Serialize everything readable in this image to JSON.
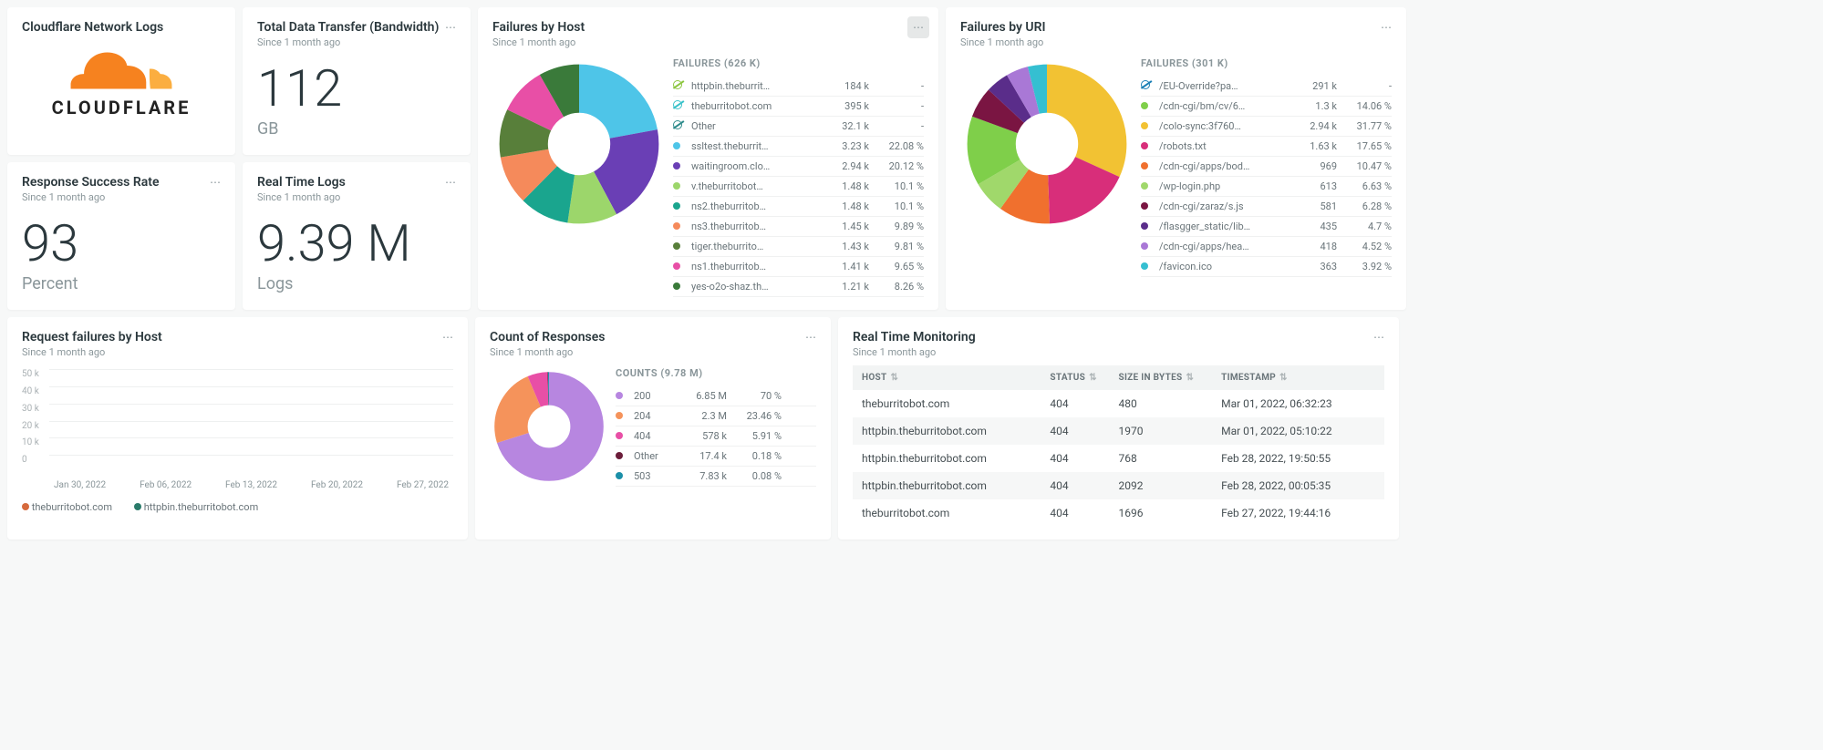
{
  "header": {
    "title": "Cloudflare Network Logs",
    "logo_word": "CLOUDFLARE"
  },
  "bandwidth": {
    "title": "Total Data Transfer (Bandwidth)",
    "sub": "Since 1 month ago",
    "value": "112",
    "unit": "GB"
  },
  "success_rate": {
    "title": "Response Success Rate",
    "sub": "Since 1 month ago",
    "value": "93",
    "unit": "Percent"
  },
  "realtime_logs": {
    "title": "Real Time Logs",
    "sub": "Since 1 month ago",
    "value": "9.39 M",
    "unit": "Logs"
  },
  "failures_host": {
    "title": "Failures by Host",
    "sub": "Since 1 month ago",
    "legend_title": "FAILURES (626 K)",
    "items": [
      {
        "label": "httpbin.theburrit…",
        "count": "184 k",
        "pct": "-",
        "null": true,
        "color": "#8cc63f"
      },
      {
        "label": "theburritobot.com",
        "count": "395 k",
        "pct": "-",
        "null": true,
        "color": "#39c2c9"
      },
      {
        "label": "Other",
        "count": "32.1 k",
        "pct": "-",
        "null": true,
        "color": "#2e8b8b"
      },
      {
        "label": "ssltest.theburrit…",
        "count": "3.23 k",
        "pct": "22.08 %",
        "color": "#4ec5e8"
      },
      {
        "label": "waitingroom.clo…",
        "count": "2.94 k",
        "pct": "20.12 %",
        "color": "#6a3fb5"
      },
      {
        "label": "v.theburritobot…",
        "count": "1.48 k",
        "pct": "10.1 %",
        "color": "#9cd66b"
      },
      {
        "label": "ns2.theburritob…",
        "count": "1.48 k",
        "pct": "10.1 %",
        "color": "#1aa58e"
      },
      {
        "label": "ns3.theburritob…",
        "count": "1.45 k",
        "pct": "9.89 %",
        "color": "#f58a5b"
      },
      {
        "label": "tiger.theburrito…",
        "count": "1.43 k",
        "pct": "9.81 %",
        "color": "#587f3a"
      },
      {
        "label": "ns1.theburritob…",
        "count": "1.41 k",
        "pct": "9.65 %",
        "color": "#e84fa6"
      },
      {
        "label": "yes-o2o-shaz.th…",
        "count": "1.21 k",
        "pct": "8.26 %",
        "color": "#3a7a3a"
      }
    ]
  },
  "failures_uri": {
    "title": "Failures by URI",
    "sub": "Since 1 month ago",
    "legend_title": "FAILURES (301 K)",
    "items": [
      {
        "label": "/EU-Override?pa…",
        "count": "291 k",
        "pct": "-",
        "null": true,
        "color": "#1b7fb5"
      },
      {
        "label": "/cdn-cgi/bm/cv/6…",
        "count": "1.3 k",
        "pct": "14.06 %",
        "color": "#7fcf4a"
      },
      {
        "label": "/colo-sync:3f760…",
        "count": "2.94 k",
        "pct": "31.77 %",
        "color": "#f2c233"
      },
      {
        "label": "/robots.txt",
        "count": "1.63 k",
        "pct": "17.65 %",
        "color": "#d82e7a"
      },
      {
        "label": "/cdn-cgi/apps/bod…",
        "count": "969",
        "pct": "10.47 %",
        "color": "#f0702e"
      },
      {
        "label": "/wp-login.php",
        "count": "613",
        "pct": "6.63 %",
        "color": "#a0d86b"
      },
      {
        "label": "/cdn-cgi/zaraz/s.js",
        "count": "581",
        "pct": "6.28 %",
        "color": "#7a1542"
      },
      {
        "label": "/flasgger_static/lib…",
        "count": "435",
        "pct": "4.7 %",
        "color": "#5a2d8a"
      },
      {
        "label": "/cdn-cgi/apps/hea…",
        "count": "418",
        "pct": "4.52 %",
        "color": "#a978d6"
      },
      {
        "label": "/favicon.ico",
        "count": "363",
        "pct": "3.92 %",
        "color": "#35bfd1"
      }
    ]
  },
  "request_failures": {
    "title": "Request failures by Host",
    "sub": "Since 1 month ago",
    "legend": [
      {
        "label": "theburritobot.com",
        "color": "#d66a3d"
      },
      {
        "label": "httpbin.theburritobot.com",
        "color": "#2a7b6a"
      }
    ]
  },
  "count_responses": {
    "title": "Count of Responses",
    "sub": "Since 1 month ago",
    "legend_title": "COUNTS (9.78 M)",
    "items": [
      {
        "label": "200",
        "count": "6.85 M",
        "pct": "70 %",
        "color": "#b786e0"
      },
      {
        "label": "204",
        "count": "2.3 M",
        "pct": "23.46 %",
        "color": "#f5935b"
      },
      {
        "label": "404",
        "count": "578 k",
        "pct": "5.91 %",
        "color": "#e84fa6"
      },
      {
        "label": "Other",
        "count": "17.4 k",
        "pct": "0.18 %",
        "color": "#6b1d3a"
      },
      {
        "label": "503",
        "count": "7.83 k",
        "pct": "0.08 %",
        "color": "#1b8fa8"
      }
    ]
  },
  "realtime_monitor": {
    "title": "Real Time Monitoring",
    "sub": "Since 1 month ago",
    "cols": [
      "HOST",
      "STATUS",
      "SIZE IN BYTES",
      "TIMESTAMP"
    ],
    "rows": [
      {
        "host": "theburritobot.com",
        "status": "404",
        "size": "480",
        "ts": "Mar 01, 2022, 06:32:23"
      },
      {
        "host": "httpbin.theburritobot.com",
        "status": "404",
        "size": "1970",
        "ts": "Mar 01, 2022, 05:10:22"
      },
      {
        "host": "httpbin.theburritobot.com",
        "status": "404",
        "size": "768",
        "ts": "Feb 28, 2022, 19:50:55"
      },
      {
        "host": "httpbin.theburritobot.com",
        "status": "404",
        "size": "2092",
        "ts": "Feb 28, 2022, 00:05:35"
      },
      {
        "host": "theburritobot.com",
        "status": "404",
        "size": "1696",
        "ts": "Feb 27, 2022, 19:44:16"
      }
    ]
  },
  "chart_data": [
    {
      "type": "pie",
      "title": "Failures by Host",
      "series": [
        {
          "name": "Failures",
          "values": [
            22.08,
            20.12,
            10.1,
            10.1,
            9.89,
            9.81,
            9.65,
            8.26
          ]
        }
      ],
      "categories": [
        "ssltest",
        "waitingroom",
        "v",
        "ns2",
        "ns3",
        "tiger",
        "ns1",
        "yes-o2o-shaz"
      ]
    },
    {
      "type": "pie",
      "title": "Failures by URI",
      "series": [
        {
          "name": "Failures",
          "values": [
            14.06,
            31.77,
            17.65,
            10.47,
            6.63,
            6.28,
            4.7,
            4.52,
            3.92
          ]
        }
      ],
      "categories": [
        "/cdn-cgi/bm/cv",
        "/colo-sync",
        "/robots.txt",
        "/cdn-cgi/apps/bod",
        "/wp-login.php",
        "/cdn-cgi/zaraz/s.js",
        "/flasgger_static",
        "/cdn-cgi/apps/hea",
        "/favicon.ico"
      ]
    },
    {
      "type": "bar",
      "title": "Request failures by Host",
      "categories": [
        "Jan 30, 2022",
        "Feb 06, 2022",
        "Feb 13, 2022",
        "Feb 20, 2022",
        "Feb 27, 2022"
      ],
      "ylim": [
        0,
        50000
      ],
      "yticks": [
        "0",
        "10 k",
        "20 k",
        "30 k",
        "40 k",
        "50 k"
      ],
      "series": [
        {
          "name": "theburritobot.com",
          "values": [
            0,
            0,
            0,
            0,
            0,
            0,
            0,
            0,
            0,
            25,
            25,
            25,
            26,
            25,
            25,
            25,
            25,
            26,
            26,
            26,
            26,
            26,
            25,
            22,
            0,
            0,
            0,
            0
          ]
        },
        {
          "name": "httpbin.theburritobot.com",
          "values": [
            0,
            0,
            0,
            0,
            0,
            0,
            0,
            0,
            0,
            0,
            16,
            16,
            16,
            16,
            17,
            17,
            17,
            17,
            17,
            17,
            17,
            17,
            17,
            16,
            13,
            0,
            0,
            0
          ]
        }
      ]
    },
    {
      "type": "pie",
      "title": "Count of Responses",
      "series": [
        {
          "name": "Counts",
          "values": [
            70,
            23.46,
            5.91,
            0.18,
            0.08
          ]
        }
      ],
      "categories": [
        "200",
        "204",
        "404",
        "Other",
        "503"
      ]
    }
  ]
}
